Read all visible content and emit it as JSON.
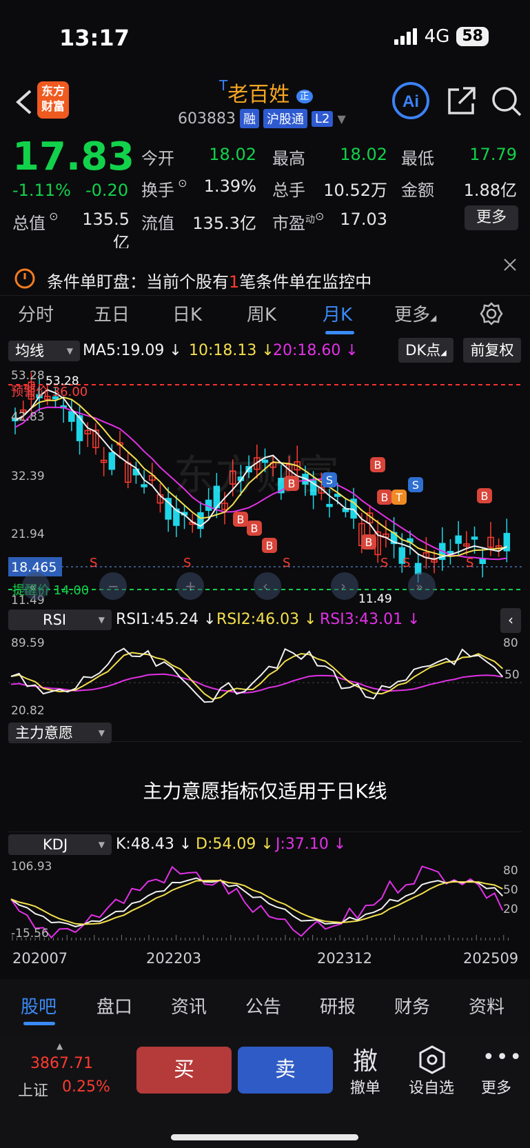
{
  "status": {
    "time": "13:17",
    "network": "4G",
    "battery": "58"
  },
  "header": {
    "logo_text": "东方财富",
    "name_prefix": "T",
    "name": "老百姓",
    "name_badge": "正",
    "code": "603883",
    "tags": [
      "融",
      "沪股通",
      "L2"
    ]
  },
  "quote": {
    "price": "17.83",
    "change_pct": "-1.11%",
    "change": "-0.20",
    "labels": {
      "open": "今开",
      "high": "最高",
      "low": "最低",
      "turnover": "换手",
      "volume": "总手",
      "amount": "金额",
      "total_cap": "总值",
      "float_cap": "流值",
      "pe": "市盈",
      "pe_sup": "动"
    },
    "open": "18.02",
    "high": "18.02",
    "low": "17.79",
    "turnover": "1.39%",
    "volume": "10.52万",
    "amount": "1.88亿",
    "total_cap": "135.5亿",
    "float_cap": "135.3亿",
    "pe": "17.03",
    "more": "更多"
  },
  "alert": {
    "prefix": "条件单盯盘：当前个股有",
    "count": "1",
    "suffix": "笔条件单在监控中"
  },
  "tabs": [
    "分时",
    "五日",
    "日K",
    "周K",
    "月K",
    "更多"
  ],
  "active_tab": "月K",
  "chart": {
    "ma_select": "均线",
    "ma5": "MA5:19.09",
    "ma10": "10:18.13",
    "ma20": "20:18.60",
    "dk_button": "DK点",
    "adjust_button": "前复权",
    "price_labels": {
      "p1": "53.28",
      "p2": "42.83",
      "p3": "32.39",
      "p4": "21.94",
      "p5": "11.49",
      "current": "18.465",
      "max_mark": "53.28",
      "min_mark": "11.49"
    },
    "stop_line": "预警价 36.00",
    "remind_line": "提醒价 14.00",
    "watermark": "东方财富",
    "colors": {
      "up": "#ff3b30",
      "down": "#1fd6e8",
      "ma5": "#f2f2f2",
      "ma10": "#f4e04d",
      "ma20": "#e331e8"
    }
  },
  "rsi": {
    "select": "RSI",
    "rsi1": "RSI1:45.24",
    "rsi2": "RSI2:46.03",
    "rsi3": "RSI3:43.01",
    "top": "89.59",
    "bottom": "20.82",
    "ticks": [
      "80",
      "50"
    ]
  },
  "main_force": {
    "select": "主力意愿",
    "notice": "主力意愿指标仅适用于日K线"
  },
  "kdj": {
    "select": "KDJ",
    "k": "K:48.43",
    "d": "D:54.09",
    "j": "J:37.10",
    "top": "106.93",
    "bottom": "-15.56",
    "ticks": [
      "80",
      "50",
      "20"
    ]
  },
  "dates": [
    "202007",
    "202203",
    "202312",
    "202509"
  ],
  "bottom_nav": [
    "股吧",
    "盘口",
    "资讯",
    "公告",
    "研报",
    "财务",
    "资料"
  ],
  "active_nav": "股吧",
  "index": {
    "value": "3867.71",
    "name": "上证",
    "pct": "0.25%"
  },
  "actions": {
    "buy": "买",
    "sell": "卖",
    "cancel_big": "撤",
    "cancel": "撤单",
    "watch": "设自选",
    "more": "更多"
  }
}
